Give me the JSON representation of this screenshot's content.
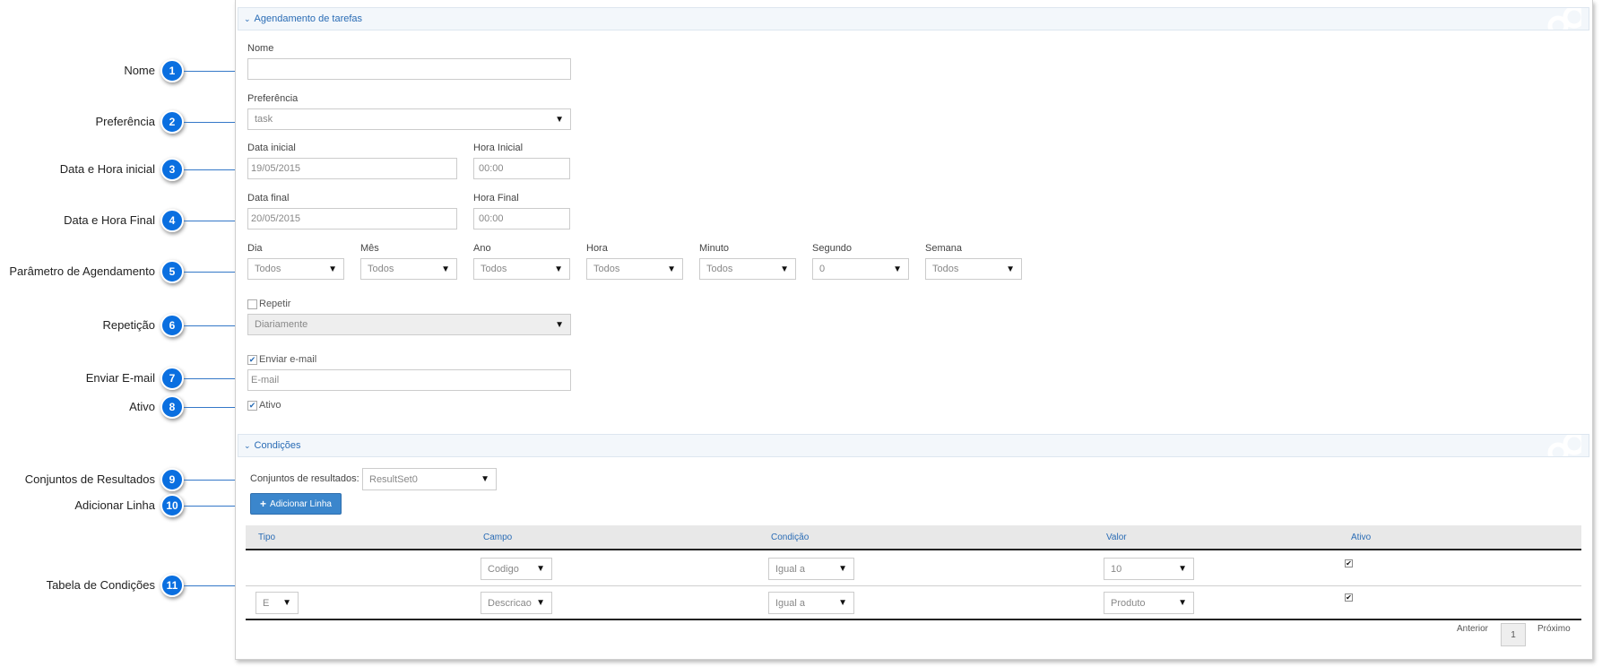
{
  "callouts": [
    {
      "num": "1",
      "label": "Nome"
    },
    {
      "num": "2",
      "label": "Preferência"
    },
    {
      "num": "3",
      "label": "Data e Hora inicial"
    },
    {
      "num": "4",
      "label": "Data e Hora Final"
    },
    {
      "num": "5",
      "label": "Parâmetro de Agendamento"
    },
    {
      "num": "6",
      "label": "Repetição"
    },
    {
      "num": "7",
      "label": "Enviar E-mail"
    },
    {
      "num": "8",
      "label": "Ativo"
    },
    {
      "num": "9",
      "label": "Conjuntos de Resultados"
    },
    {
      "num": "10",
      "label": "Adicionar Linha"
    },
    {
      "num": "11",
      "label": "Tabela de Condições"
    }
  ],
  "schedule": {
    "section_title": "Agendamento de tarefas",
    "nome_label": "Nome",
    "nome_value": "",
    "pref_label": "Preferência",
    "pref_value": "task",
    "data_inicial_label": "Data inicial",
    "data_inicial_value": "19/05/2015",
    "hora_inicial_label": "Hora Inicial",
    "hora_inicial_value": "00:00",
    "data_final_label": "Data final",
    "data_final_value": "20/05/2015",
    "hora_final_label": "Hora Final",
    "hora_final_value": "00:00",
    "params": [
      {
        "label": "Dia",
        "value": "Todos"
      },
      {
        "label": "Mês",
        "value": "Todos"
      },
      {
        "label": "Ano",
        "value": "Todos"
      },
      {
        "label": "Hora",
        "value": "Todos"
      },
      {
        "label": "Minuto",
        "value": "Todos"
      },
      {
        "label": "Segundo",
        "value": "0"
      },
      {
        "label": "Semana",
        "value": "Todos"
      }
    ],
    "repetir_label": "Repetir",
    "repetir_checked": false,
    "repeticao_value": "Diariamente",
    "email_label": "Enviar e-mail",
    "email_checked": true,
    "email_placeholder": "E-mail",
    "ativo_label": "Ativo",
    "ativo_checked": true
  },
  "conditions": {
    "section_title": "Condições",
    "resultset_label": "Conjuntos de resultados:",
    "resultset_value": "ResultSet0",
    "add_button": "Adicionar Linha",
    "columns": [
      "Tipo",
      "Campo",
      "Condição",
      "Valor",
      "Ativo"
    ],
    "rows": [
      {
        "tipo": "",
        "campo": "Codigo",
        "condicao": "Igual a",
        "valor": "10",
        "ativo": true
      },
      {
        "tipo": "E",
        "campo": "Descricao",
        "condicao": "Igual a",
        "valor": "Produto",
        "ativo": true
      }
    ],
    "pager": {
      "prev": "Anterior",
      "page": "1",
      "next": "Próximo"
    }
  },
  "icons": {
    "arrow": "▼",
    "chevron": "⌄",
    "check": "✔",
    "plus": "+"
  },
  "colors": {
    "accent": "#2a6cb5",
    "badge": "#0a6fe0",
    "button": "#3b86cc"
  }
}
